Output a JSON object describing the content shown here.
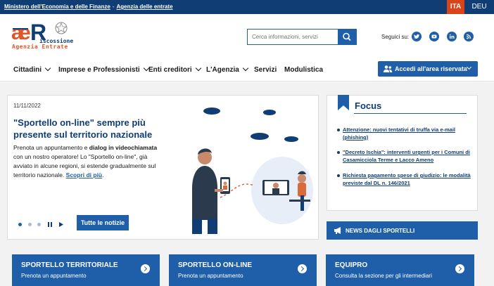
{
  "topbar": {
    "link1": "Ministero dell'Economia e delle Finanze",
    "separator": "-",
    "link2": "Agenzia delle entrate",
    "lang_active": "ITA",
    "lang_other": "DEU"
  },
  "header": {
    "logo_mark": "AeR",
    "logo_title": "iscossione",
    "logo_subtitle": "Agenzia Entrate",
    "search_placeholder": "Cerca informazioni, servizi",
    "social_label": "Seguici su:",
    "social_icons": [
      "twitter-icon",
      "youtube-icon",
      "linkedin-icon",
      "rss-icon"
    ]
  },
  "nav": {
    "items": [
      {
        "label": "Cittadini",
        "has_menu": true
      },
      {
        "label": "Imprese e Professionisti",
        "has_menu": true
      },
      {
        "label": "Enti creditori",
        "has_menu": true
      },
      {
        "label": "L'Agenzia",
        "has_menu": true
      },
      {
        "label": "Servizi",
        "has_menu": false
      },
      {
        "label": "Modulistica",
        "has_menu": false
      }
    ],
    "reserved_area": "Accedi all'area riservata"
  },
  "news": {
    "date": "11/11/2022",
    "title": "\"Sportello on-line\" sempre più presente sul territorio nazionale",
    "body_1": "Prenota un appuntamento e ",
    "body_bold": "dialog in videochiamata",
    "body_2": " con un nostro operatore! Lo \"Sportello on-line\", già avviato in alcune regioni, si estende gradualmente sul territorio nazionale. ",
    "more": "Scopri di più",
    "after_more": ".",
    "all_news": "Tutte le notizie",
    "carousel_dots": 3,
    "active_dot": 1
  },
  "focus": {
    "title": "Focus",
    "items": [
      "Attenzione: nuovi tentativi di truffa via e-mail (phishing)",
      "\"Decreto Ischia\": interventi urgenti per i Comuni di Casamicciola Terme e Lacco Ameno",
      "Richiesta pagamento spese di giudizio: le modalità previste dal DL n. 146/2021"
    ]
  },
  "sportelli_news": "NEWS DAGLI SPORTELLI",
  "tiles": [
    {
      "title": "SPORTELLO TERRITORIALE",
      "subtitle": "Prenota un appuntamento"
    },
    {
      "title": "SPORTELLO ON-LINE",
      "subtitle": "Prenota un appuntamento"
    },
    {
      "title": "EQUIPRO",
      "subtitle": "Consulta la sezione per gli intermediari"
    }
  ],
  "colors": {
    "primary": "#1f5ea8",
    "dark_blue": "#0f3d74",
    "accent_orange": "#d9441b"
  }
}
